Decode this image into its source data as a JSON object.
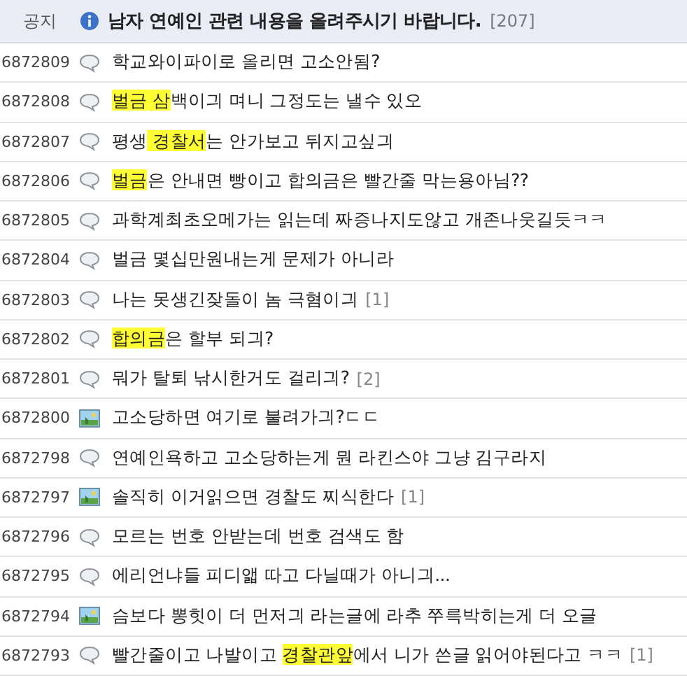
{
  "notice": {
    "label": "공지",
    "title": "남자 연예인 관련 내용을 올려주시기 바랍니다.",
    "count": "[207]"
  },
  "posts": [
    {
      "number": "6872809",
      "kind": "text",
      "parts": [
        {
          "text": "학교와이파이로 올리면 고소안됨?",
          "highlight": false
        }
      ]
    },
    {
      "number": "6872808",
      "kind": "text",
      "parts": [
        {
          "text": "벌금 삼",
          "highlight": true
        },
        {
          "text": "백이긔 며니 그정도는 낼수 있오",
          "highlight": false
        }
      ]
    },
    {
      "number": "6872807",
      "kind": "text",
      "parts": [
        {
          "text": "평생",
          "highlight": false
        },
        {
          "text": " 경찰서",
          "highlight": true
        },
        {
          "text": "는 안가보고 뒤지고싶긔",
          "highlight": false
        }
      ]
    },
    {
      "number": "6872806",
      "kind": "text",
      "parts": [
        {
          "text": "벌금",
          "highlight": true
        },
        {
          "text": "은 안내면 빵이고 합의금은 빨간줄 막는용아님??",
          "highlight": false
        }
      ]
    },
    {
      "number": "6872805",
      "kind": "text",
      "parts": [
        {
          "text": "과학계최초오메가는 읽는데 짜증나지도않고 개존나웃길듯ㅋㅋ",
          "highlight": false
        }
      ]
    },
    {
      "number": "6872804",
      "kind": "text",
      "parts": [
        {
          "text": "벌금 몇십만원내는게 문제가 아니라",
          "highlight": false
        }
      ]
    },
    {
      "number": "6872803",
      "kind": "text",
      "parts": [
        {
          "text": "나는 못생긴잦돌이 놈 극혐이긔",
          "highlight": false
        }
      ],
      "comments": "[1]"
    },
    {
      "number": "6872802",
      "kind": "text",
      "parts": [
        {
          "text": "합의금",
          "highlight": true
        },
        {
          "text": "은 할부 되긔?",
          "highlight": false
        }
      ]
    },
    {
      "number": "6872801",
      "kind": "text",
      "parts": [
        {
          "text": "뭐가 탈퇴 낚시한거도 걸리긔?",
          "highlight": false
        }
      ],
      "comments": "[2]"
    },
    {
      "number": "6872800",
      "kind": "image",
      "parts": [
        {
          "text": "고소당하면 여기로 불려가긔?ㄷㄷ",
          "highlight": false
        }
      ]
    },
    {
      "number": "6872798",
      "kind": "text",
      "parts": [
        {
          "text": "연예인욕하고 고소당하는게 뭔 라킨스야 그냥 김구라지",
          "highlight": false
        }
      ]
    },
    {
      "number": "6872797",
      "kind": "image",
      "parts": [
        {
          "text": "솔직히 이거읽으면 경찰도 찌식한다",
          "highlight": false
        }
      ],
      "comments": "[1]"
    },
    {
      "number": "6872796",
      "kind": "text",
      "parts": [
        {
          "text": "모르는 번호 안받는데 번호 검색도 함",
          "highlight": false
        }
      ]
    },
    {
      "number": "6872795",
      "kind": "text",
      "parts": [
        {
          "text": "에리언냐들 피디앫 따고 다닐때가 아니긔...",
          "highlight": false
        }
      ]
    },
    {
      "number": "6872794",
      "kind": "image",
      "parts": [
        {
          "text": "슴보다 뽕힛이 더 먼저긔 라는글에 라추 쭈륵박히는게 더 오글",
          "highlight": false
        }
      ]
    },
    {
      "number": "6872793",
      "kind": "text",
      "parts": [
        {
          "text": "빨간줄이고 나발이고 ",
          "highlight": false
        },
        {
          "text": "경찰관앞",
          "highlight": true
        },
        {
          "text": "에서 니가 쓴글 읽어야된다고 ㅋㅋ",
          "highlight": false
        }
      ],
      "comments": "[1]"
    }
  ]
}
